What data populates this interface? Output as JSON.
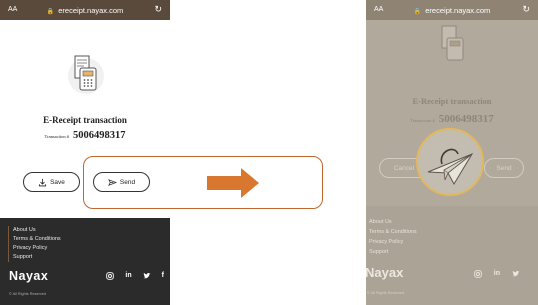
{
  "browser": {
    "text_size_label": "AA",
    "url": "ereceipt.nayax.com",
    "lock_icon": "lock-icon",
    "reload_icon": "reload-icon"
  },
  "left_screen": {
    "title": "E-Receipt transaction",
    "transaction_label": "Transaction #",
    "transaction_number": "5006498317",
    "buttons": {
      "save": "Save",
      "send": "Send"
    },
    "footer": {
      "links": [
        "About Us",
        "Terms & Conditions",
        "Privacy Policy",
        "Support"
      ],
      "brand": "Nayax",
      "copyright": "© All Rights Reserved",
      "social": [
        "instagram-icon",
        "linkedin-icon",
        "twitter-icon",
        "facebook-icon"
      ],
      "social_glyphs": {
        "linkedin": "in",
        "facebook": "f"
      }
    }
  },
  "right_screen": {
    "title": "E-Receipt transaction",
    "transaction_label": "Transaction #",
    "transaction_number": "5006498317",
    "buttons": {
      "cancel": "Cancel",
      "send": "Send"
    },
    "footer": {
      "links": [
        "About Us",
        "Terms & Conditions",
        "Privacy Policy",
        "Support"
      ],
      "brand": "Nayax",
      "copyright": "© All Rights Reserved",
      "social_glyphs": {
        "linkedin": "in"
      }
    }
  },
  "colors": {
    "highlight": "#c0672e",
    "arrow": "#d8772f",
    "browser_bar": "#5a4a3c",
    "footer_dark": "#2b2b2b",
    "overlay": "#b1a99c"
  }
}
